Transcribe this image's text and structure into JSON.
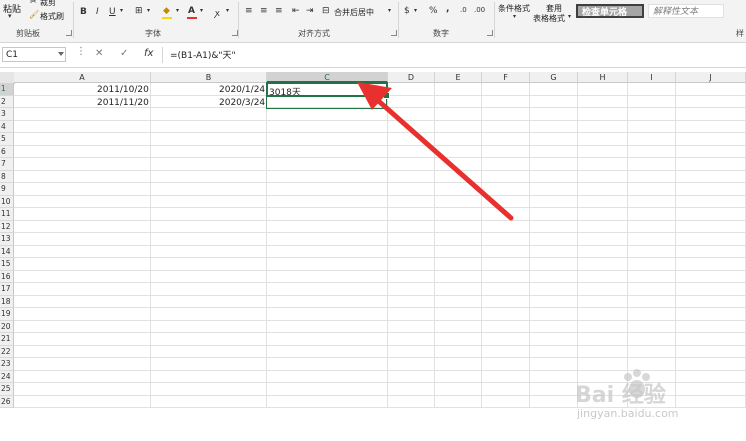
{
  "ribbon": {
    "clipboard": {
      "paste": "粘贴",
      "cut": "裁剪",
      "format_painter": "格式刷",
      "group": "剪贴板"
    },
    "font": {
      "bold": "B",
      "italic": "I",
      "underline": "U",
      "font_color": "A",
      "group": "字体"
    },
    "alignment": {
      "merge_center": "合并后居中",
      "group": "对齐方式"
    },
    "number": {
      "percent": "%",
      "comma": ",",
      "group": "数字"
    },
    "styles": {
      "conditional_format": "条件格式",
      "table_format_1": "套用",
      "table_format_2": "表格格式",
      "check_cell": "检查单元格",
      "explanatory_text": "解释性文本",
      "group_partial": "样"
    }
  },
  "formula_bar": {
    "name_box": "C1",
    "cancel": "✕",
    "enter": "✓",
    "fx": "fx",
    "formula": "=(B1-A1)&\"天\""
  },
  "grid": {
    "columns": [
      "A",
      "B",
      "C",
      "D",
      "E",
      "F",
      "G",
      "H",
      "I",
      "J"
    ],
    "rows": [
      "1",
      "2",
      "3",
      "4",
      "5",
      "6",
      "7",
      "8",
      "9",
      "10",
      "11",
      "12",
      "13",
      "14",
      "15",
      "16",
      "17",
      "18",
      "19",
      "20",
      "21",
      "22",
      "23",
      "24",
      "25",
      "26"
    ],
    "cells": {
      "A1": "2011/10/20",
      "B1": "2020/1/24",
      "C1": "3018天",
      "A2": "2011/11/20",
      "B2": "2020/3/24"
    },
    "active_cell": "C1"
  },
  "watermark": {
    "brand": "Bai 经验",
    "url": "jingyan.baidu.com"
  },
  "colors": {
    "selection": "#217346",
    "arrow": "#e8312f",
    "ribbon_bg": "#f3f3f3"
  }
}
